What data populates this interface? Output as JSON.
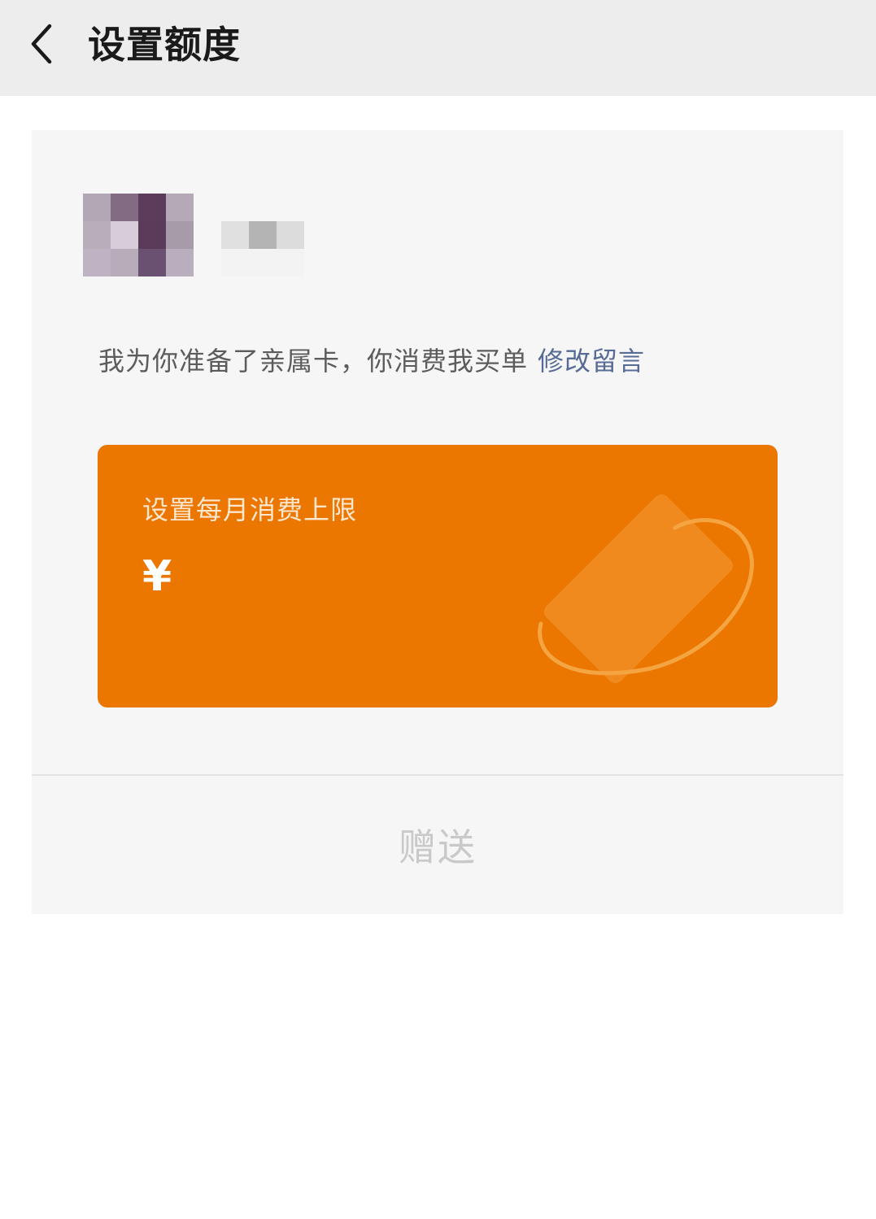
{
  "header": {
    "title": "设置额度",
    "back_icon": "chevron-left-icon"
  },
  "recipient": {
    "avatar_pixels": [
      "#b2a7b4",
      "#846b84",
      "#5b3d5b",
      "#b6a9b7",
      "#b7aeba",
      "#d9ccd9",
      "#5a3c5a",
      "#a89ba9",
      "#bdb3c3",
      "#b8acbb",
      "#6b5171",
      "#b9aebe"
    ],
    "nickname_pixels": [
      "#e0e0e0",
      "#b4b4b4",
      "#dcdcdc"
    ]
  },
  "message": {
    "text": "我为你准备了亲属卡，你消费我买单",
    "edit_link": "修改留言"
  },
  "card": {
    "title": "设置每月消费上限",
    "currency": "¥",
    "amount": "",
    "background_color": "#eb7700",
    "decoration_icon": "card-orbit-icon"
  },
  "actions": {
    "gift_label": "赠送"
  }
}
